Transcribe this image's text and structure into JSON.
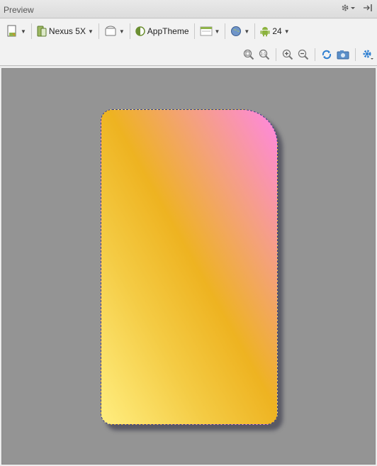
{
  "panel": {
    "title": "Preview"
  },
  "toolbar": {
    "device_label": "Nexus 5X",
    "theme_label": "AppTheme",
    "api_level": "24"
  },
  "colors": {
    "canvas_bg": "#949494",
    "device_border": "#3c3f8a",
    "gradient_start": "#ffee80",
    "gradient_mid": "#eeb321",
    "gradient_end": "#ff87e3"
  },
  "icons": {
    "titlebar": [
      "gear-icon",
      "hide-icon"
    ],
    "toolbar1": [
      "design-surface-icon",
      "device-icon",
      "orientation-icon",
      "theme-icon",
      "activity-icon",
      "locale-icon",
      "android-icon"
    ],
    "toolbar2": [
      "zoom-to-fit-icon",
      "actual-size-icon",
      "zoom-in-icon",
      "zoom-out-icon",
      "refresh-icon",
      "screenshot-icon",
      "settings-icon"
    ]
  }
}
